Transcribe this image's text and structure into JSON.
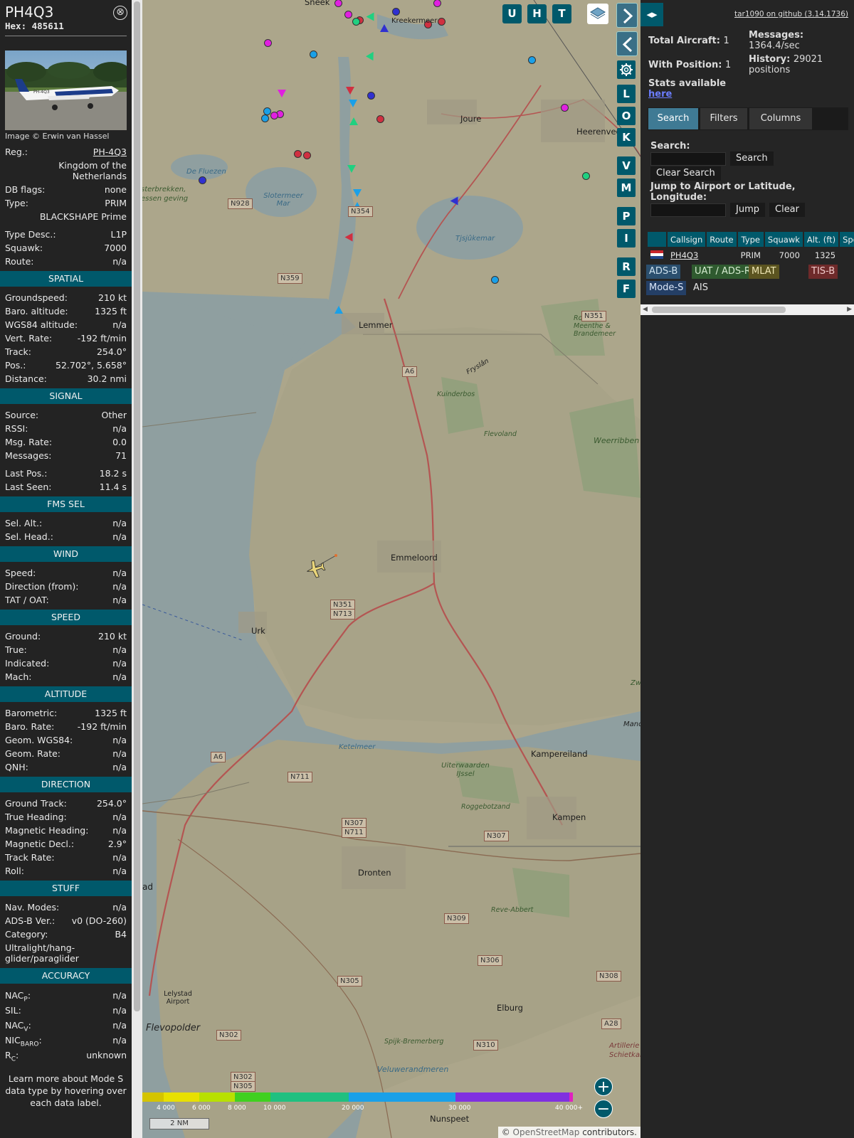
{
  "info": {
    "callsign": "PH4Q3",
    "hex_label": "Hex:",
    "hex": "485611",
    "close": "⊗",
    "image_credit": "Image © Erwin van Hassel",
    "photo_reg": "PH-4Q3",
    "reg_label": "Reg.:",
    "reg": "PH-4Q3",
    "country": "Kingdom of the Netherlands",
    "dbflags_label": "DB flags:",
    "dbflags": "none",
    "type_label": "Type:",
    "type": "PRIM",
    "type_full": "BLACKSHAPE Prime",
    "typedesc_label": "Type Desc.:",
    "typedesc": "L1P",
    "squawk_label": "Squawk:",
    "squawk": "7000",
    "route_label": "Route:",
    "route": "n/a",
    "sections": {
      "spatial": "SPATIAL",
      "signal": "SIGNAL",
      "fms": "FMS SEL",
      "wind": "WIND",
      "speed": "SPEED",
      "altitude": "ALTITUDE",
      "direction": "DIRECTION",
      "stuff": "STUFF",
      "accuracy": "ACCURACY"
    },
    "spatial": [
      {
        "label": "Groundspeed:",
        "value": "210 kt"
      },
      {
        "label": "Baro. altitude:",
        "value": "1325 ft"
      },
      {
        "label": "WGS84 altitude:",
        "value": "n/a"
      },
      {
        "label": "Vert. Rate:",
        "value": "-192 ft/min"
      },
      {
        "label": "Track:",
        "value": "254.0°"
      },
      {
        "label": "Pos.:",
        "value": "52.702°, 5.658°"
      },
      {
        "label": "Distance:",
        "value": "30.2 nmi"
      }
    ],
    "signal": [
      {
        "label": "Source:",
        "value": "Other"
      },
      {
        "label": "RSSI:",
        "value": "n/a"
      },
      {
        "label": "Msg. Rate:",
        "value": "0.0"
      },
      {
        "label": "Messages:",
        "value": "71"
      }
    ],
    "signal2": [
      {
        "label": "Last Pos.:",
        "value": "18.2 s"
      },
      {
        "label": "Last Seen:",
        "value": "11.4 s"
      }
    ],
    "fms": [
      {
        "label": "Sel. Alt.:",
        "value": "n/a"
      },
      {
        "label": "Sel. Head.:",
        "value": "n/a"
      }
    ],
    "wind": [
      {
        "label": "Speed:",
        "value": "n/a"
      },
      {
        "label": "Direction (from):",
        "value": "n/a"
      },
      {
        "label": "TAT / OAT:",
        "value": "n/a"
      }
    ],
    "speed": [
      {
        "label": "Ground:",
        "value": "210 kt"
      },
      {
        "label": "True:",
        "value": "n/a"
      },
      {
        "label": "Indicated:",
        "value": "n/a"
      },
      {
        "label": "Mach:",
        "value": "n/a"
      }
    ],
    "altitude": [
      {
        "label": "Barometric:",
        "value": "1325 ft"
      },
      {
        "label": "Baro. Rate:",
        "value": "-192 ft/min"
      },
      {
        "label": "Geom. WGS84:",
        "value": "n/a"
      },
      {
        "label": "Geom. Rate:",
        "value": "n/a"
      },
      {
        "label": "QNH:",
        "value": "n/a"
      }
    ],
    "direction": [
      {
        "label": "Ground Track:",
        "value": "254.0°"
      },
      {
        "label": "True Heading:",
        "value": "n/a"
      },
      {
        "label": "Magnetic Heading:",
        "value": "n/a"
      },
      {
        "label": "Magnetic Decl.:",
        "value": "2.9°"
      },
      {
        "label": "Track Rate:",
        "value": "n/a"
      },
      {
        "label": "Roll:",
        "value": "n/a"
      }
    ],
    "stuff": [
      {
        "label": "Nav. Modes:",
        "value": "n/a"
      },
      {
        "label": "ADS-B Ver.:",
        "value": "v0 (DO-260)"
      },
      {
        "label": "Category:",
        "value": "B4"
      }
    ],
    "category_desc": "Ultralight/hang-glider/paraglider",
    "accuracy": [
      {
        "label": "NAC",
        "sub": "P",
        "value": "n/a"
      },
      {
        "label": "SIL:",
        "sub": "",
        "value": "n/a"
      },
      {
        "label": "NAC",
        "sub": "V",
        "value": "n/a"
      },
      {
        "label": "NIC",
        "sub": "BARO",
        "value": "n/a"
      },
      {
        "label": "R",
        "sub": "C",
        "value": "unknown"
      }
    ],
    "note": "Learn more about Mode S data type by hovering over each data label."
  },
  "map": {
    "top_buttons": [
      "U",
      "H",
      "T"
    ],
    "side_buttons": [
      "L",
      "O",
      "K",
      "V",
      "M",
      "P",
      "I",
      "R",
      "F"
    ],
    "zoom_in": "+",
    "zoom_out": "−",
    "scale_label": "2 NM",
    "attribution_prefix": "© ",
    "attribution_link": "OpenStreetMap",
    "attribution_suffix": " contributors.",
    "altitude_scale": [
      "4 000",
      "6 000",
      "8 000",
      "10 000",
      "20 000",
      "30 000",
      "40 000+"
    ],
    "places": [
      "Sneek",
      "Kreekermeer",
      "Joure",
      "Heerenveen",
      "De Fluezen",
      "Slotermeer Mar",
      "Tjsjûkemar",
      "Lemmer",
      "Rottige Meenthe & Brandemeer",
      "Kuinderbos",
      "Flevoland",
      "Weerribben",
      "Emmeloord",
      "Urk",
      "Ketelmeer",
      "Kampereiland",
      "Uiterwaarden IJssel",
      "Roggebotzand",
      "Kampen",
      "Dronten",
      "Reve-Abbert",
      "Elburg",
      "Lelystad Airport",
      "Flevopolder",
      "Spijk-Bremerberg",
      "Veluwerandmeren",
      "Nunspeet",
      "Artillerie Schietkamp",
      "Mand",
      "Zw",
      "Fryslân",
      "sterbrekken, essen geving",
      "ad"
    ],
    "roads": [
      "N928",
      "N354",
      "N359",
      "N351",
      "A6",
      "N351",
      "N713",
      "A6",
      "N711",
      "N307",
      "N711",
      "N307",
      "N309",
      "N306",
      "N305",
      "N308",
      "N302",
      "A28",
      "N310",
      "N302",
      "N305"
    ]
  },
  "panel": {
    "collapse_icon": "◂▸",
    "github_link": "tar1090 on github (3.14.1736)",
    "total_aircraft_label": "Total Aircraft:",
    "total_aircraft": "1",
    "with_position_label": "With Position:",
    "with_position": "1",
    "messages_label": "Messages:",
    "messages": "1364.4/sec",
    "history_label": "History:",
    "history": "29021 positions",
    "stats_label": "Stats available",
    "stats_link": "here",
    "tabs": [
      "Search",
      "Filters",
      "Columns"
    ],
    "search_label": "Search:",
    "search_button": "Search",
    "clear_search_button": "Clear Search",
    "jump_label": "Jump to Airport or Latitude, Longitude:",
    "jump_button": "Jump",
    "clear_button": "Clear",
    "table_headers": [
      "",
      "Callsign",
      "Route",
      "Type",
      "Squawk",
      "Alt. (ft)",
      "Spd."
    ],
    "table_rows": [
      {
        "callsign": "PH4Q3",
        "route": "",
        "type": "PRIM",
        "squawk": "7000",
        "alt": "1325",
        "spd": ""
      }
    ],
    "legend": [
      {
        "label": "ADS-B",
        "bg": "#2b4f6e",
        "color": "#cfe3f0"
      },
      {
        "label": "UAT / ADS-R",
        "bg": "#2f5a2f",
        "color": "#d5ecd0"
      },
      {
        "label": "MLAT",
        "bg": "#5b5420",
        "color": "#efe7b4"
      },
      {
        "label": "TIS-B",
        "bg": "#6e2a2a",
        "color": "#f3cccc"
      },
      {
        "label": "Mode-S",
        "bg": "#243f66",
        "color": "#dbe6f8"
      },
      {
        "label": "AIS",
        "bg": "transparent",
        "color": "#e6e6e6"
      }
    ]
  },
  "colors": {
    "section_bg": "#00596b",
    "panel_bg": "#252525",
    "map_bg": "#aca68b",
    "water": "#8ea2a0",
    "accent_blue": "#3f7a94"
  }
}
